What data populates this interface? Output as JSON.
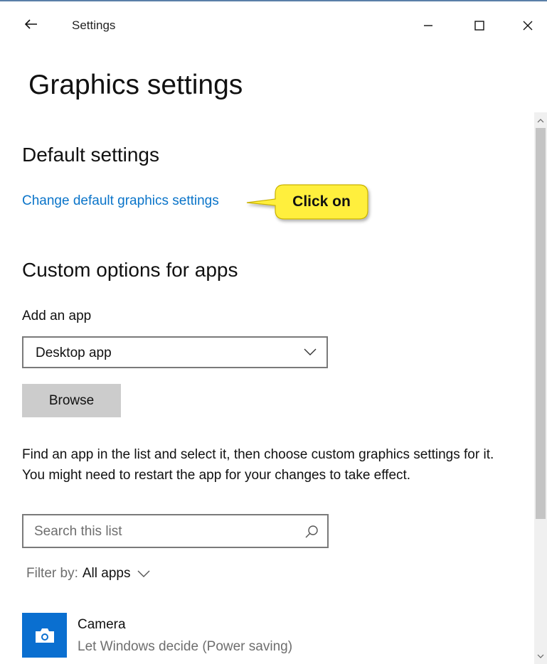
{
  "window": {
    "app_title": "Settings",
    "icons": {
      "back": "arrow-left-icon",
      "minimize": "minimize-icon",
      "maximize": "maximize-icon",
      "close": "close-icon"
    }
  },
  "page": {
    "title": "Graphics settings"
  },
  "default_settings": {
    "heading": "Default settings",
    "link": "Change default graphics settings"
  },
  "callout": {
    "text": "Click on",
    "color": "#ffef3d"
  },
  "custom_options": {
    "heading": "Custom options for apps",
    "add_label": "Add an app",
    "dropdown_value": "Desktop app",
    "browse_label": "Browse",
    "instructions": "Find an app in the list and select it, then choose custom graphics settings for it. You might need to restart the app for your changes to take effect.",
    "search_placeholder": "Search this list",
    "filter_label": "Filter by:",
    "filter_value": "All apps"
  },
  "apps": [
    {
      "name": "Camera",
      "setting": "Let Windows decide (Power saving)",
      "icon": "camera-icon",
      "icon_bg": "#0a6fd0"
    }
  ],
  "colors": {
    "accent": "#0a74c9",
    "button_bg": "#cccccc"
  }
}
